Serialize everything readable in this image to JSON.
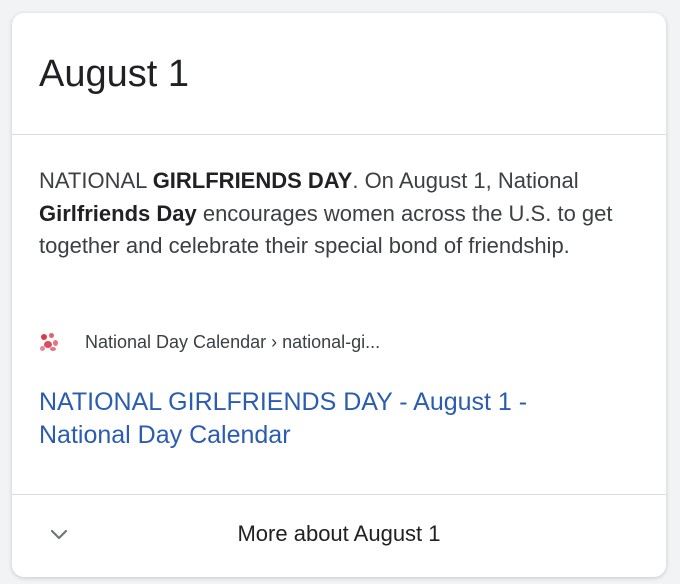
{
  "card": {
    "title": "August 1",
    "snippet": {
      "p1": "NATIONAL ",
      "b1": "GIRLFRIENDS DAY",
      "p2": ". On August 1, National ",
      "b2": "Girlfriends Day",
      "p3": " encourages women across the U.S. to get together and celebrate their special bond of friendship."
    },
    "source": {
      "favicon": "national-day-calendar-favicon",
      "text": "National Day Calendar › national-gi..."
    },
    "link_text": "NATIONAL GIRLFRIENDS DAY - August 1 - National Day Calendar",
    "footer": {
      "icon": "chevron-down-icon",
      "label": "More about August 1"
    }
  },
  "colors": {
    "link": "#2a5db0",
    "text": "#3c4043",
    "divider": "#dadce0",
    "background": "#f1f3f4"
  }
}
